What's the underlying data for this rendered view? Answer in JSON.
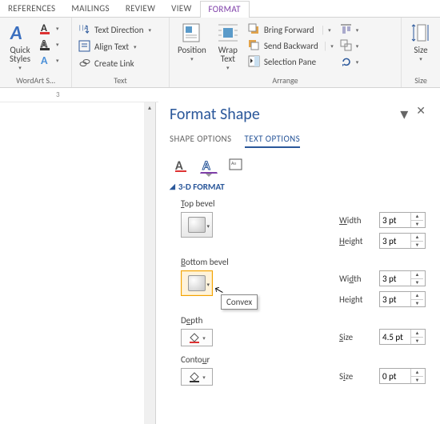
{
  "ribbon": {
    "tabs": [
      "REFERENCES",
      "MAILINGS",
      "REVIEW",
      "VIEW",
      "FORMAT"
    ],
    "wordart_group": "WordArt S…",
    "quick_styles": "Quick\nStyles",
    "text_group": {
      "label": "Text",
      "text_direction": "Text Direction",
      "align_text": "Align Text",
      "create_link": "Create Link"
    },
    "arrange": {
      "label": "Arrange",
      "position": "Position",
      "wrap_text": "Wrap\nText",
      "bring_forward": "Bring Forward",
      "send_backward": "Send Backward",
      "selection_pane": "Selection Pane"
    },
    "size_group": {
      "label": "Size",
      "size": "Size"
    }
  },
  "ruler_mark": "3",
  "pane": {
    "title": "Format Shape",
    "tabs": {
      "shape": "SHAPE OPTIONS",
      "text": "TEXT OPTIONS"
    },
    "section": "3-D FORMAT",
    "top_bevel": "Top bevel",
    "bottom_bevel": "Bottom bevel",
    "depth": "Depth",
    "contour": "Contour",
    "width": "Width",
    "height": "Height",
    "size": "Size",
    "values": {
      "top_width": "3 pt",
      "top_height": "3 pt",
      "bottom_width": "3 pt",
      "bottom_height": "3 pt",
      "depth_size": "4.5 pt",
      "contour_size": "0 pt"
    },
    "tooltip": "Convex"
  }
}
